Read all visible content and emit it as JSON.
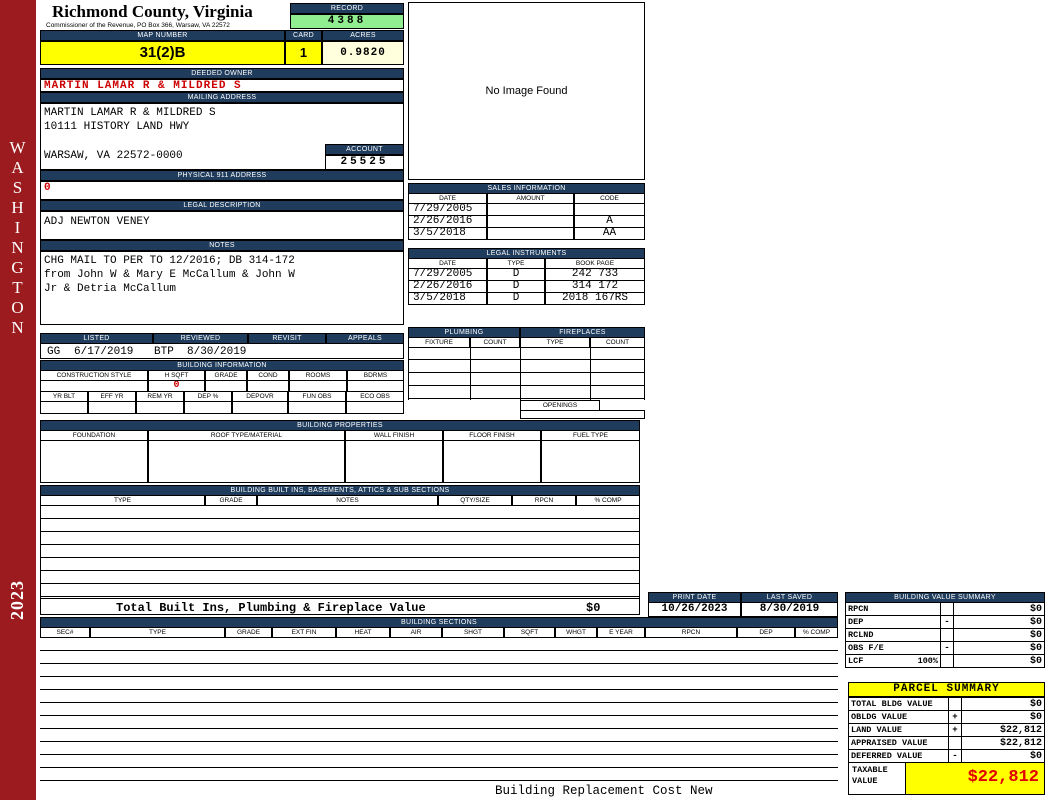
{
  "sidebar": {
    "state": "WASHINGTON",
    "year": "2023"
  },
  "header": {
    "county": "Richmond County, Virginia",
    "commissioner": "Commissioner of the Revenue, PO Box 366, Warsaw, VA 22572",
    "record_label": "RECORD",
    "record_value": "4388",
    "map_number_label": "MAP NUMBER",
    "map_number_value": "31(2)B",
    "card_label": "CARD",
    "card_value": "1",
    "acres_label": "ACRES",
    "acres_value": "0.9820"
  },
  "owner": {
    "deeded_owner_label": "DEEDED OWNER",
    "deeded_owner": "MARTIN LAMAR R & MILDRED S",
    "mailing_address_label": "MAILING ADDRESS",
    "mailing_lines": [
      "MARTIN LAMAR R & MILDRED S",
      "10111 HISTORY LAND HWY",
      "WARSAW, VA 22572-0000"
    ],
    "account_label": "ACCOUNT",
    "account_value": "25525",
    "physical_label": "PHYSICAL 911 ADDRESS",
    "physical_value": "0",
    "legal_label": "LEGAL DESCRIPTION",
    "legal_value": "ADJ NEWTON VENEY",
    "notes_label": "NOTES",
    "notes_lines": [
      "CHG MAIL TO PER TO 12/2016; DB 314-172",
      "from John W & Mary E McCallum & John W",
      "Jr & Detria McCallum"
    ]
  },
  "image_box": {
    "text": "No Image Found"
  },
  "sales": {
    "title": "SALES INFORMATION",
    "columns": [
      "DATE",
      "AMOUNT",
      "CODE"
    ],
    "rows": [
      [
        "7/29/2005",
        "",
        ""
      ],
      [
        "2/26/2016",
        "",
        "A"
      ],
      [
        "3/5/2018",
        "",
        "AA"
      ]
    ]
  },
  "legal_instruments": {
    "title": "LEGAL INSTRUMENTS",
    "columns": [
      "DATE",
      "TYPE",
      "BOOK PAGE"
    ],
    "rows": [
      [
        "7/29/2005",
        "D",
        "242 733"
      ],
      [
        "2/26/2016",
        "D",
        "314 172"
      ],
      [
        "3/5/2018",
        "D",
        "2018 167RS"
      ]
    ]
  },
  "plumbing": {
    "title": "PLUMBING",
    "columns": [
      "FIXTURE",
      "COUNT"
    ]
  },
  "fireplaces": {
    "title": "FIREPLACES",
    "columns": [
      "TYPE",
      "COUNT"
    ],
    "openings_label": "OPENINGS"
  },
  "listing": {
    "columns": [
      "LISTED",
      "REVIEWED",
      "REVISIT",
      "APPEALS"
    ],
    "listed_by": "GG",
    "listed_date": "6/17/2019",
    "reviewed_by": "BTP",
    "reviewed_date": "8/30/2019"
  },
  "building_information": {
    "title": "BUILDING INFORMATION",
    "row1_columns": [
      "CONSTRUCTION STYLE",
      "H SQFT",
      "GRADE",
      "COND",
      "ROOMS",
      "BDRMS"
    ],
    "h_sqft_value": "0",
    "row2_columns": [
      "YR BLT",
      "EFF YR",
      "REM YR",
      "DEP %",
      "DEPOVR",
      "FUN OBS",
      "ECO OBS"
    ]
  },
  "building_properties": {
    "title": "BUILDING PROPERTIES",
    "columns": [
      "FOUNDATION",
      "ROOF TYPE/MATERIAL",
      "WALL FINISH",
      "FLOOR FINISH",
      "FUEL TYPE"
    ]
  },
  "built_ins": {
    "title": "BUILDING BUILT INS, BASEMENTS, ATTICS & SUB SECTIONS",
    "columns": [
      "TYPE",
      "GRADE",
      "NOTES",
      "QTY/SIZE",
      "RPCN",
      "% COMP"
    ],
    "total_label": "Total Built Ins, Plumbing & Fireplace Value",
    "total_value": "$0"
  },
  "print_info": {
    "print_date_label": "PRINT DATE",
    "print_date": "10/26/2023",
    "last_saved_label": "LAST SAVED",
    "last_saved": "8/30/2019"
  },
  "building_value_summary": {
    "title": "BUILDING VALUE SUMMARY",
    "rows": [
      [
        "RPCN",
        "",
        "$0"
      ],
      [
        "DEP",
        "-",
        "$0"
      ],
      [
        "RCLND",
        "",
        "$0"
      ],
      [
        "OBS F/E",
        "-",
        "$0"
      ],
      [
        "LCF",
        "",
        "$0"
      ]
    ],
    "lcf_pct": "100%"
  },
  "building_sections": {
    "title": "BUILDING SECTIONS",
    "columns": [
      "SEC#",
      "TYPE",
      "GRADE",
      "EXT FIN",
      "HEAT",
      "AIR",
      "SHGT",
      "SQFT",
      "WHGT",
      "E YEAR",
      "RPCN",
      "DEP",
      "% COMP"
    ]
  },
  "parcel_summary": {
    "title": "PARCEL SUMMARY",
    "rows": [
      [
        "TOTAL BLDG VALUE",
        "",
        "$0"
      ],
      [
        "OBLDG VALUE",
        "+",
        "$0"
      ],
      [
        "LAND VALUE",
        "+",
        "$22,812"
      ],
      [
        "APPRAISED VALUE",
        "",
        "$22,812"
      ],
      [
        "DEFERRED VALUE",
        "-",
        "$0"
      ]
    ],
    "taxable_label_1": "TAXABLE",
    "taxable_label_2": "VALUE",
    "taxable_value": "$22,812"
  },
  "footer": {
    "text": "Building Replacement Cost New"
  },
  "colors": {
    "accent_navy": "#1F3C5C",
    "record_green": "#90EE90",
    "highlight_yellow": "#FFFF00",
    "sidebar_red": "#9B1B1E",
    "alert_red": "#CC0000"
  }
}
